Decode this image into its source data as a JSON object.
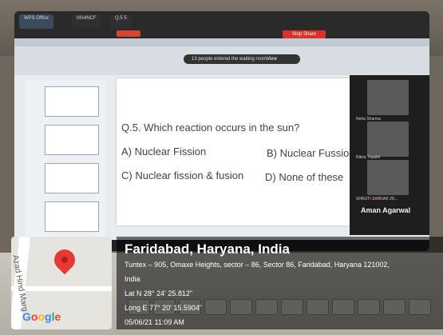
{
  "screen": {
    "tabs": [
      "WPS Office",
      "MS4NCF",
      "Q.5 5"
    ],
    "ribbon_button": "Stop Share",
    "notice": "13 people entered the waiting room.",
    "notice_action": "View"
  },
  "slide": {
    "question": "Q.5. Which reaction occurs in the sun?",
    "options": {
      "a": "A) Nuclear Fission",
      "b": "B) Nuclear Fussion",
      "c": "C) Nuclear fission & fusion",
      "d": "D) None of these"
    }
  },
  "participants": {
    "names": [
      "Neha Sharma",
      "Nikita Tripathi",
      "SHRUTI SARKAR 2D..."
    ],
    "presenter": "Aman Agarwal"
  },
  "geo": {
    "title": "Faridabad, Haryana, India",
    "address_line1": "Tuntex – 905, Omaxe Heights, sector – 86, Sector 86, Faridabad, Haryana 121002,",
    "address_line2": "India",
    "lat": "Lat N 28° 24' 25.812\"",
    "long": "Long E 77° 20' 15.5904\"",
    "datetime": "05/06/21 11:09 AM",
    "map_road": "Azad Hind Marg",
    "map_brand": "Google"
  },
  "colors": {
    "pin": "#e53935",
    "stop_share": "#d8322b"
  }
}
